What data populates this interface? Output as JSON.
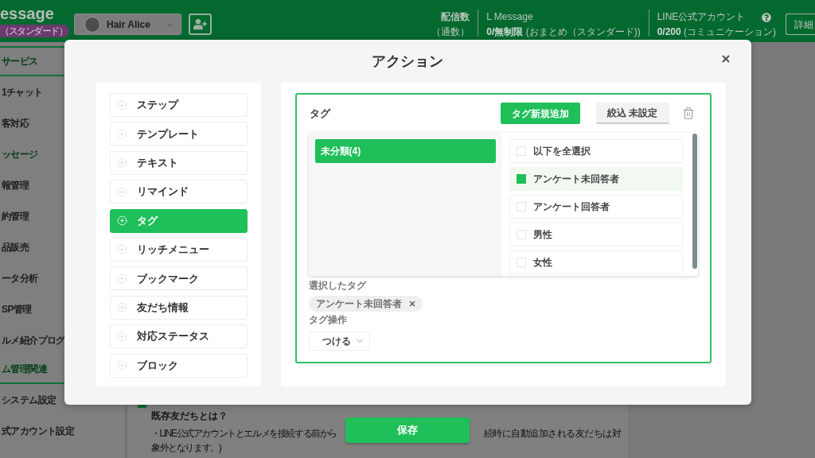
{
  "header": {
    "logo_text": "essage",
    "plan_badge": "（スタンダード）",
    "account_select": "Hair Alice",
    "delivery_count": {
      "label": "配信数",
      "unit": "（通数）"
    },
    "quotas": [
      {
        "title": "L Message",
        "value": "**0/無制限** (おまとめ（スタンダード))"
      },
      {
        "title": "LINE公式アカウント",
        "value": "**0/200** (コミュニケーション)"
      }
    ],
    "details_button": "詳細"
  },
  "sidebar": {
    "items": [
      {
        "label": "サービス",
        "kind": "section"
      },
      {
        "label": "1チャット",
        "kind": "link"
      },
      {
        "label": "客対応",
        "kind": "link"
      },
      {
        "label": "ッセージ",
        "kind": "subsection"
      },
      {
        "label": "報管理",
        "kind": "link"
      },
      {
        "label": "約管理",
        "kind": "link"
      },
      {
        "label": "品販売",
        "kind": "link"
      },
      {
        "label": "ータ分析",
        "kind": "link"
      },
      {
        "label": "SP管理",
        "kind": "link"
      },
      {
        "label": "ルメ紹介プログ",
        "kind": "link"
      },
      {
        "label": "ム管理関連",
        "kind": "section"
      },
      {
        "label": "システム設定",
        "kind": "link"
      },
      {
        "label": "式アカウント設定",
        "kind": "link"
      }
    ]
  },
  "main": {
    "notice": {
      "heading": "既存友だちとは？",
      "rows": [
        [
          "・LINE公式アカウントとエルメを接続する前から",
          "続時に自動追加される友だちは対"
        ],
        [
          "象外となります。)"
        ]
      ]
    }
  },
  "modal": {
    "title": "アクション",
    "actions": [
      {
        "label": "ステップ",
        "selected": false
      },
      {
        "label": "テンプレート",
        "selected": false
      },
      {
        "label": "テキスト",
        "selected": false
      },
      {
        "label": "リマインド",
        "selected": false
      },
      {
        "label": "タグ",
        "selected": true
      },
      {
        "label": "リッチメニュー",
        "selected": false
      },
      {
        "label": "ブックマーク",
        "selected": false
      },
      {
        "label": "友だち情報",
        "selected": false
      },
      {
        "label": "対応ステータス",
        "selected": false
      },
      {
        "label": "ブロック",
        "selected": false
      }
    ],
    "tag_panel": {
      "title": "タグ",
      "add_button": "タグ新規追加",
      "filter_button": "絞込 未設定",
      "categories": [
        {
          "label": "未分類(4)",
          "selected": true
        }
      ],
      "tags": [
        {
          "label": "以下を全選択",
          "checked": false
        },
        {
          "label": "アンケート未回答者",
          "checked": true
        },
        {
          "label": "アンケート回答者",
          "checked": false
        },
        {
          "label": "男性",
          "checked": false
        },
        {
          "label": "女性",
          "checked": false
        }
      ],
      "selected_label": "選択したタグ",
      "selected_tags": [
        "アンケート未回答者"
      ],
      "operation_label": "タグ操作",
      "operation_select": "つける"
    },
    "save_button": "保存"
  }
}
